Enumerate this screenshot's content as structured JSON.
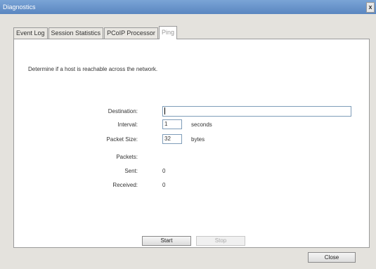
{
  "window": {
    "title": "Diagnostics",
    "close_glyph": "x"
  },
  "tabs": [
    {
      "label": "Event Log",
      "active": false
    },
    {
      "label": "Session Statistics",
      "active": false
    },
    {
      "label": "PCoIP Processor",
      "active": false
    },
    {
      "label": "Ping",
      "active": true
    }
  ],
  "ping": {
    "description": "Determine if a host is reachable across the network.",
    "destination_label": "Destination:",
    "destination_value": "",
    "interval_label": "Interval:",
    "interval_value": "1",
    "interval_unit": "seconds",
    "packet_size_label": "Packet Size:",
    "packet_size_value": "32",
    "packet_size_unit": "bytes",
    "packets_label": "Packets:",
    "sent_label": "Sent:",
    "sent_value": "0",
    "received_label": "Received:",
    "received_value": "0",
    "start_label": "Start",
    "stop_label": "Stop"
  },
  "footer": {
    "close_label": "Close"
  },
  "colors": {
    "titlebar": "#5a86c0",
    "window_bg": "#e4e2dd",
    "panel_bg": "#ffffff",
    "input_border": "#7f9db9"
  }
}
